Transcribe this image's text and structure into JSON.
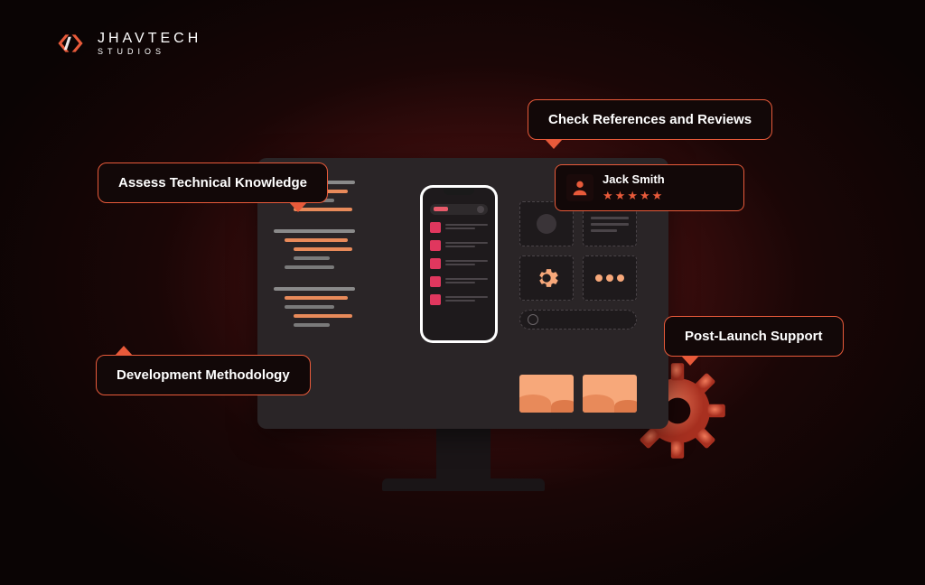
{
  "brand": {
    "title": "JHAVTECH",
    "subtitle": "STUDIOS"
  },
  "callouts": {
    "assess": "Assess Technical Knowledge",
    "methodology": "Development Methodology",
    "references": "Check References and Reviews",
    "support": "Post-Launch Support"
  },
  "review": {
    "name": "Jack Smith",
    "rating": 5
  },
  "colors": {
    "accent": "#e85a3a",
    "pink": "#e0375e",
    "lightOrange": "#f7a87a"
  }
}
